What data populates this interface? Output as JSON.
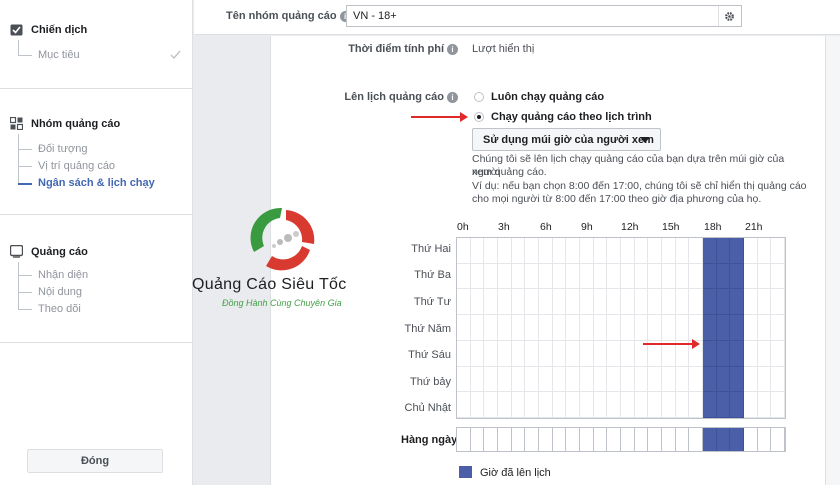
{
  "sidebar": {
    "campaign": {
      "title": "Chiến dịch",
      "items": [
        {
          "label": "Mục tiêu"
        }
      ]
    },
    "adset": {
      "title": "Nhóm quảng cáo",
      "items": [
        {
          "label": "Đối tượng"
        },
        {
          "label": "Vị trí quảng cáo"
        },
        {
          "label": "Ngân sách & lịch chạy"
        }
      ]
    },
    "ad": {
      "title": "Quảng cáo",
      "items": [
        {
          "label": "Nhận diện"
        },
        {
          "label": "Nội dung"
        },
        {
          "label": "Theo dõi"
        }
      ]
    },
    "close_label": "Đóng"
  },
  "topbar": {
    "adset_name_label": "Tên nhóm quảng cáo",
    "adset_name_value": "VN - 18+"
  },
  "form": {
    "charge_label": "Thời điểm tính phí",
    "charge_value": "Lượt hiển thị",
    "schedule_label": "Lên lịch quảng cáo",
    "options": [
      {
        "label": "Luôn chạy quảng cáo",
        "selected": false
      },
      {
        "label": "Chạy quảng cáo theo lịch trình",
        "selected": true
      }
    ],
    "timezone_button": "Sử dụng múi giờ của người xem",
    "desc1a": "Chúng tôi sẽ lên lịch chạy quảng cáo của bạn dựa trên múi giờ của người",
    "desc1b": "xem quảng cáo.",
    "desc2a": "Ví dụ: nếu bạn chọn 8:00 đến 17:00, chúng tôi sẽ chỉ hiển thị quảng cáo",
    "desc2b": "cho mọi người từ 8:00 đến 17:00 theo giờ địa phương của họ."
  },
  "schedule": {
    "hour_labels": [
      "0h",
      "3h",
      "6h",
      "9h",
      "12h",
      "15h",
      "18h",
      "21h"
    ],
    "days": [
      "Thứ Hai",
      "Thứ Ba",
      "Thứ Tư",
      "Thứ Năm",
      "Thứ Sáu",
      "Thứ bảy",
      "Chủ Nhật"
    ],
    "daily_label": "Hàng ngày",
    "active_hours": [
      18,
      19,
      20
    ],
    "legend": "Giờ đã lên lịch",
    "accent": "#4a5fa8"
  },
  "watermark": {
    "brand": "Quảng Cáo Siêu Tốc",
    "tagline": "Đồng Hành Cùng Chuyên Gia"
  }
}
